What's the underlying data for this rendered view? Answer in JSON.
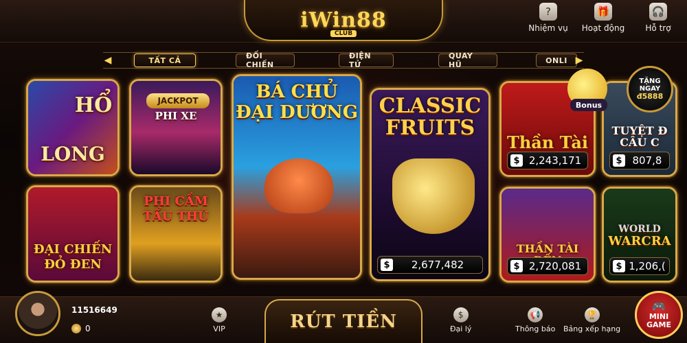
{
  "header": {
    "logo": "iWin88",
    "logo_sub": "CLUB",
    "actions": [
      {
        "label": "Nhiệm vụ",
        "icon": "mission-icon"
      },
      {
        "label": "Hoạt động",
        "icon": "gift-icon"
      },
      {
        "label": "Hỗ trợ",
        "icon": "support-icon"
      }
    ]
  },
  "tabs": [
    "TẤT CẢ",
    "ĐỐI CHIẾN",
    "ĐIỆN TỬ",
    "QUAY HŨ",
    "ONLI"
  ],
  "games": {
    "ho_long": {
      "title_a": "HỔ",
      "title_b": "LONG"
    },
    "phi_xe": {
      "badge": "JACKPOT",
      "title": "PHI XE"
    },
    "ba_chu": {
      "title_a": "BÁ CHỦ",
      "title_b": "ĐẠI DƯƠNG"
    },
    "classic": {
      "title_a": "CLASSIC",
      "title_b": "FRUITS",
      "currency": "$",
      "jackpot": "2,677,482"
    },
    "than_tai": {
      "title": "Thần Tài",
      "currency": "$",
      "jackpot": "2,243,171"
    },
    "tuyet_dinh": {
      "title": "TUYỆT Đ CÂU C",
      "currency": "$",
      "jackpot": "807,8"
    },
    "dai_chien": {
      "title_a": "ĐẠI CHIẾN",
      "title_b": "ĐỎ ĐEN"
    },
    "phi_cam": {
      "title_a": "PHI CẦM",
      "title_b": "TẨU THÚ"
    },
    "than_tai_den": {
      "title": "THẦN TÀI ĐẾN",
      "currency": "$",
      "jackpot": "2,720,081"
    },
    "warcraft": {
      "title_a": "WORLD",
      "title_b": "WARCRA",
      "currency": "$",
      "jackpot": "1,206,("
    }
  },
  "promo": {
    "bonus": "Bonus",
    "gift_line1": "TẶNG",
    "gift_line2": "NGAY",
    "gift_amount": "đ5888"
  },
  "footer": {
    "user_id": "11516649",
    "coins": "0",
    "vip_label": "VIP",
    "withdraw_label": "RÚT TIỀN",
    "agent_label": "Đại lý",
    "notify_label": "Thông báo",
    "rank_label": "Bảng xếp hạng",
    "mini_line1": "MINI",
    "mini_line2": "GAME"
  },
  "colors": {
    "gold": "#d9a94a",
    "accent": "#ffd75a",
    "dark": "#140b08"
  }
}
